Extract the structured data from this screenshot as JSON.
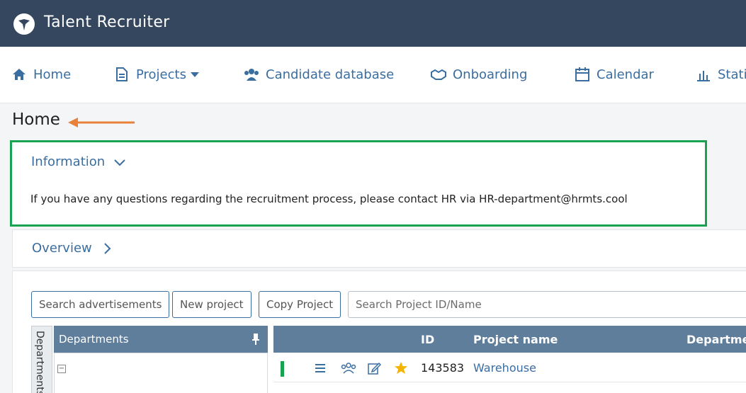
{
  "app": {
    "title": "Talent Recruiter"
  },
  "nav": {
    "home": "Home",
    "projects": "Projects",
    "candidates": "Candidate database",
    "onboarding": "Onboarding",
    "calendar": "Calendar",
    "statistics": "Stati"
  },
  "page": {
    "title": "Home"
  },
  "info": {
    "heading": "Information",
    "text": "If you have any questions regarding the recruitment process, please contact HR via HR-department@hrmts.cool"
  },
  "overview": {
    "heading": "Overview"
  },
  "toolbar": {
    "search_ads": "Search advertisements",
    "new_project": "New project",
    "copy_project": "Copy Project",
    "search_placeholder": "Search Project ID/Name"
  },
  "departments": {
    "vertical_tab": "Departments",
    "header": "Departments",
    "toggle": "−"
  },
  "grid": {
    "columns": [
      "ID",
      "Project name",
      "Departmen"
    ],
    "rows": [
      {
        "id": "143583",
        "name": "Warehouse"
      }
    ]
  },
  "colors": {
    "accent": "#3a6da0",
    "topbar": "#34475e",
    "highlight_border": "#17a34f",
    "arrow": "#e8823a",
    "star": "#f4b400"
  }
}
